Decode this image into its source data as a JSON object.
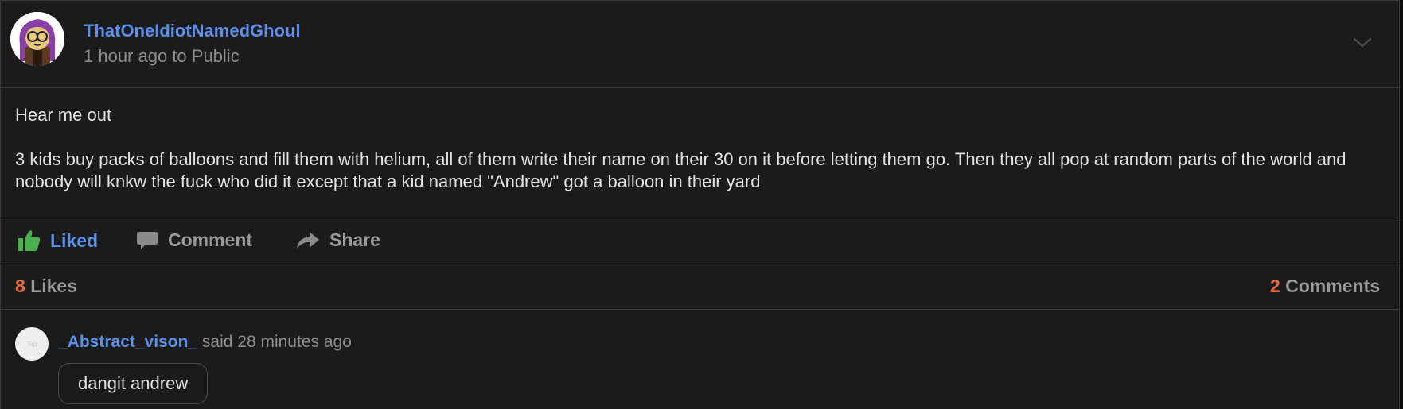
{
  "post": {
    "author": "ThatOneIdiotNamedGhoul",
    "meta": "1 hour ago to Public",
    "body": [
      "Hear me out",
      "3 kids buy packs of balloons and fill them with helium, all of them write their name on their 30 on it before letting them go. Then they all pop at random parts of the world and nobody will knkw the fuck who did it except that a kid named \"Andrew\" got a balloon in their yard"
    ],
    "actions": {
      "liked": "Liked",
      "comment": "Comment",
      "share": "Share"
    },
    "stats": {
      "likes_count": "8",
      "likes_label": "Likes",
      "comments_count": "2",
      "comments_label": "Comments"
    }
  },
  "comment": {
    "avatar_text": "Tap",
    "author": "_Abstract_vison_",
    "meta": "said 28 minutes ago",
    "text": "dangit andrew"
  },
  "icons": {
    "avatar": "cartoon-avatar",
    "menu": "chevron-down-icon",
    "liked": "thumbs-up-icon",
    "comment": "speech-bubble-icon",
    "share": "share-arrow-icon"
  },
  "colors": {
    "background": "#1b1b1b",
    "link": "#5b8fe8",
    "liked_icon": "#4caf50",
    "count_accent": "#e8683c",
    "muted": "#9a9a9a"
  }
}
